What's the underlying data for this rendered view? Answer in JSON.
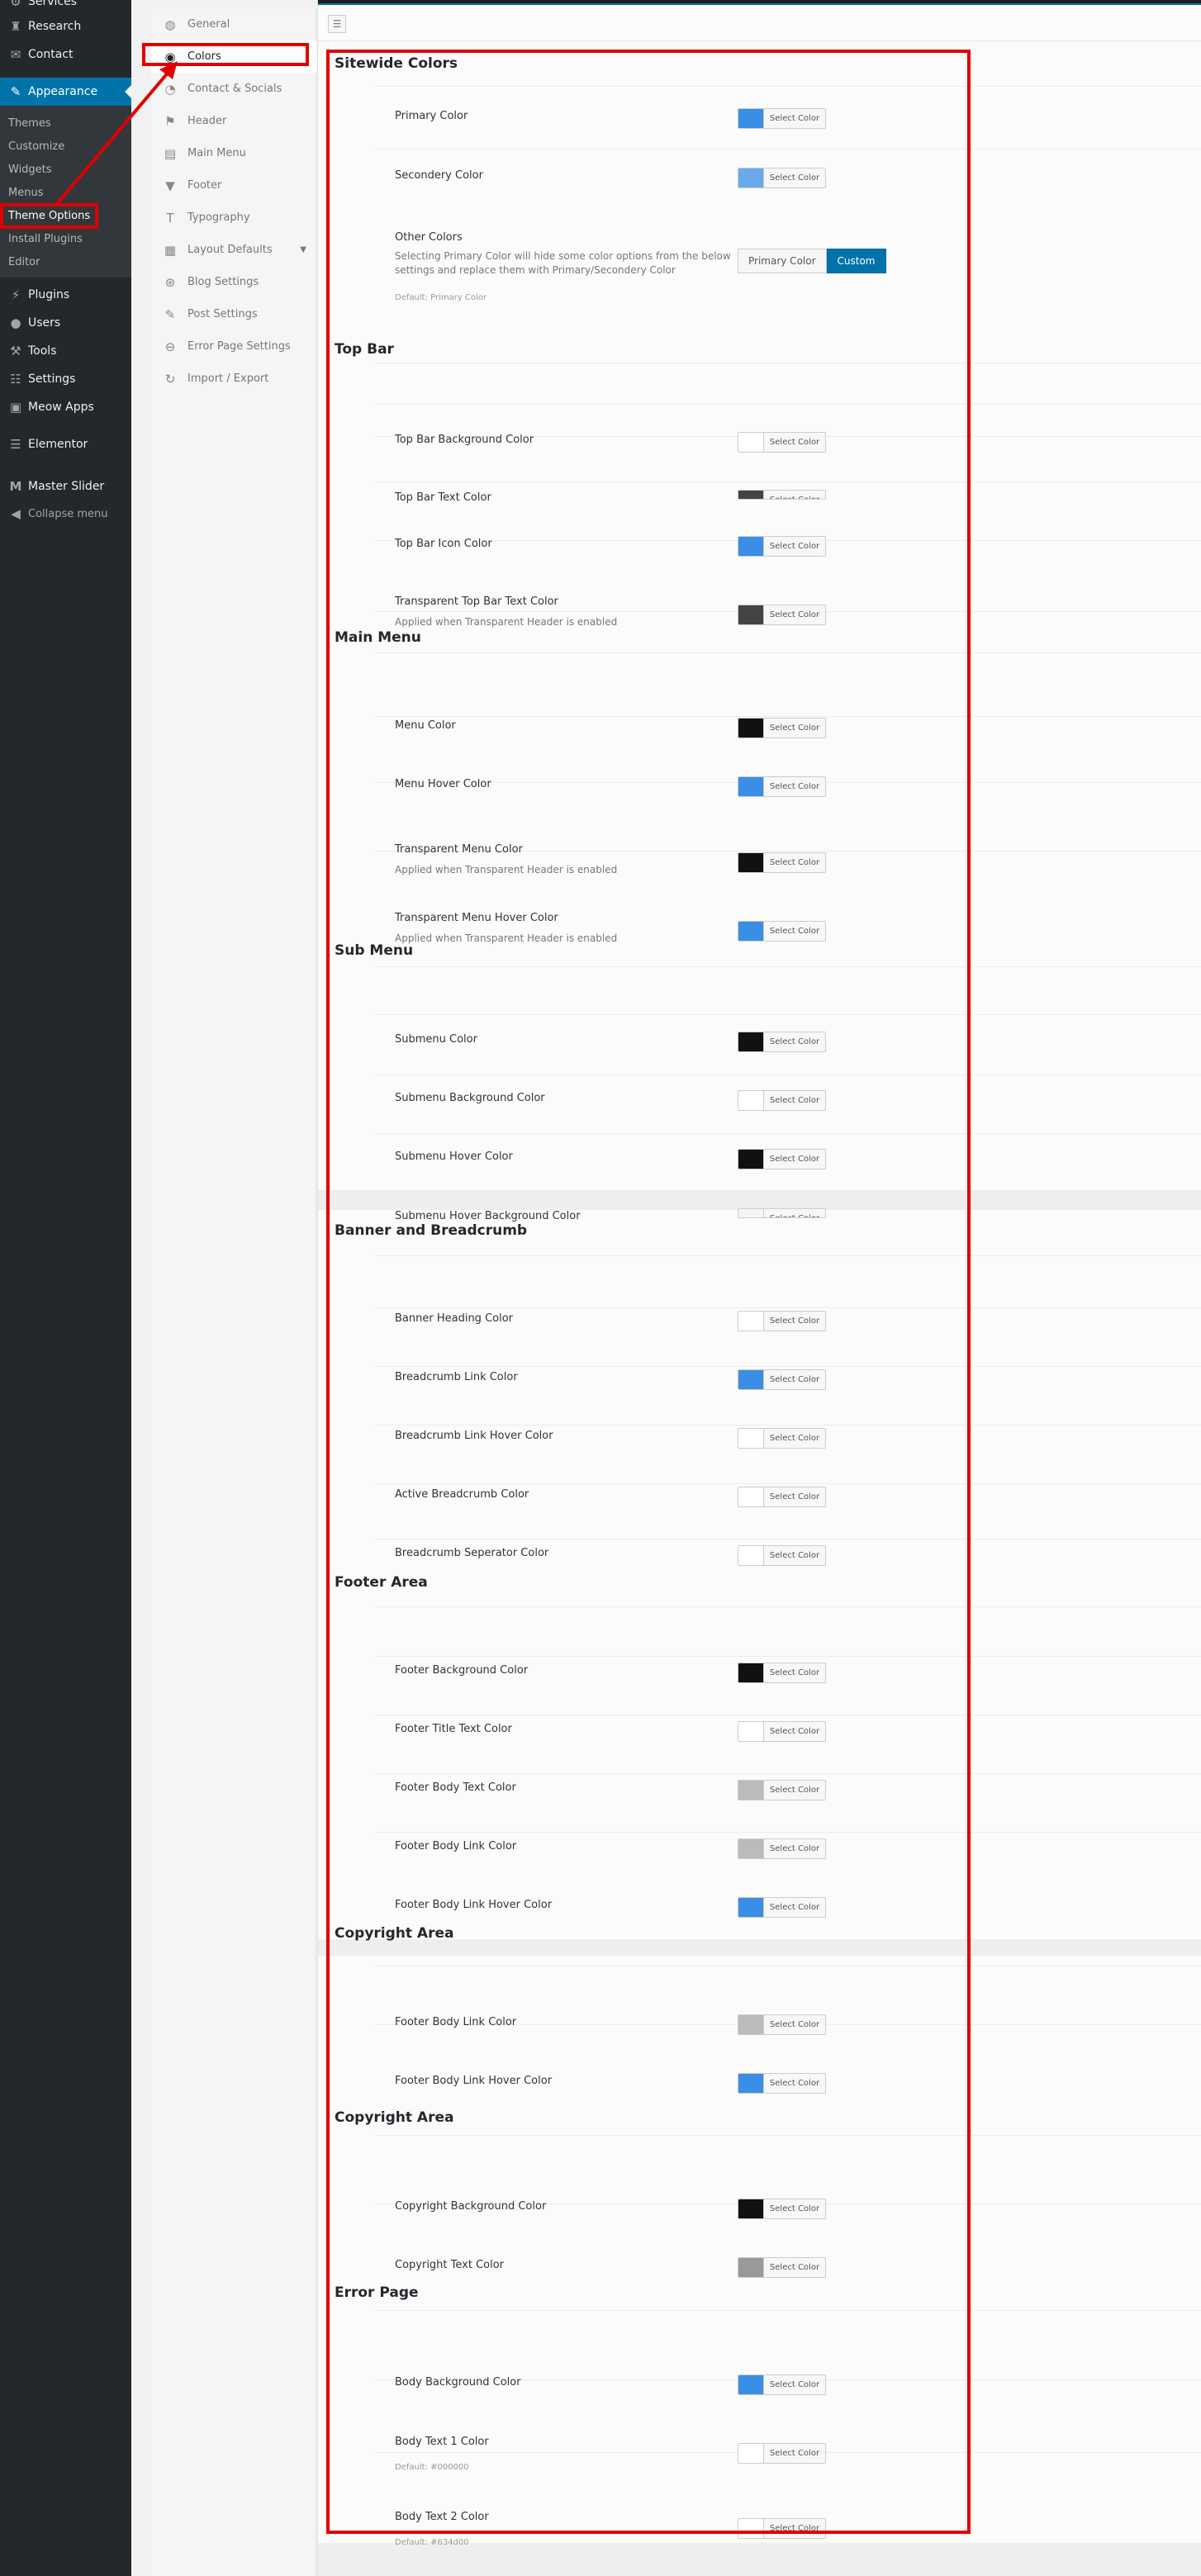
{
  "wp_menu": {
    "services": "Services",
    "research": "Research",
    "contact": "Contact",
    "appearance": "Appearance",
    "appearance_sub": [
      "Themes",
      "Customize",
      "Widgets",
      "Menus",
      "Theme Options",
      "Install Plugins",
      "Editor"
    ],
    "plugins": "Plugins",
    "users": "Users",
    "tools": "Tools",
    "settings": "Settings",
    "meow_apps": "Meow Apps",
    "elementor": "Elementor",
    "master_slider": "Master Slider",
    "collapse": "Collapse menu"
  },
  "options_nav": [
    "General",
    "Colors",
    "Contact & Socials",
    "Header",
    "Main Menu",
    "Footer",
    "Typography",
    "Layout Defaults",
    "Blog Settings",
    "Post Settings",
    "Error Page Settings",
    "Import / Export"
  ],
  "select_color_label": "Select Color",
  "sections": [
    {
      "title": "Sitewide Colors",
      "fields": [
        {
          "label": "Primary Color",
          "color": "#3a8ee6"
        },
        {
          "label": "Secondery Color",
          "color": "#6aa9ea"
        },
        {
          "label": "Other Colors",
          "desc": "Selecting Primary Color will hide some color options from the below settings and replace them with Primary/Secondery Color",
          "default": "Default: Primary Color",
          "buttons": [
            "Primary Color",
            "Custom"
          ]
        }
      ]
    },
    {
      "title": "Top Bar",
      "fields": [
        {
          "label": "Top Bar Background Color",
          "color": "#ffffff"
        },
        {
          "label": "Top Bar Text Color",
          "color": "#444444"
        },
        {
          "label": "Top Bar Icon Color",
          "color": "#3a8ee6"
        },
        {
          "label": "Transparent Top Bar Text Color",
          "desc": "Applied when Transparent Header is enabled",
          "color": "#444444"
        }
      ]
    },
    {
      "title": "Main Menu",
      "fields": [
        {
          "label": "Menu Color",
          "color": "#111111"
        },
        {
          "label": "Menu Hover Color",
          "color": "#3a8ee6"
        },
        {
          "label": "Transparent Menu Color",
          "desc": "Applied when Transparent Header is enabled",
          "color": "#111111"
        },
        {
          "label": "Transparent Menu Hover Color",
          "desc": "Applied when Transparent Header is enabled",
          "color": "#3a8ee6"
        }
      ]
    },
    {
      "title": "Sub Menu",
      "fields": [
        {
          "label": "Submenu Color",
          "color": "#111111"
        },
        {
          "label": "Submenu Background Color",
          "color": "#ffffff"
        },
        {
          "label": "Submenu Hover Color",
          "color": "#111111"
        },
        {
          "label": "Submenu Hover Background Color",
          "color": "#f2f5f8"
        }
      ]
    },
    {
      "title": "Banner and Breadcrumb",
      "fields": [
        {
          "label": "Banner Heading Color",
          "color": "#ffffff"
        },
        {
          "label": "Breadcrumb Link Color",
          "color": "#3a8ee6"
        },
        {
          "label": "Breadcrumb Link Hover Color",
          "color": "#ffffff"
        },
        {
          "label": "Active Breadcrumb Color",
          "color": "#ffffff"
        },
        {
          "label": "Breadcrumb Seperator Color",
          "color": "#ffffff"
        }
      ]
    },
    {
      "title": "Footer Area",
      "fields": [
        {
          "label": "Footer Background Color",
          "color": "#111111"
        },
        {
          "label": "Footer Title Text Color",
          "color": "#ffffff"
        },
        {
          "label": "Footer Body Text Color",
          "color": "#bbbbbb"
        },
        {
          "label": "Footer Body Link Color",
          "color": "#bbbbbb"
        },
        {
          "label": "Footer Body Link Hover Color",
          "color": "#3a8ee6"
        }
      ]
    },
    {
      "title": "Copyright Area",
      "fields": [
        {
          "label": "Footer Body Link Color",
          "color": "#bbbbbb"
        },
        {
          "label": "Footer Body Link Hover Color",
          "color": "#3a8ee6"
        }
      ]
    },
    {
      "title": "Copyright Area",
      "fields": [
        {
          "label": "Copyright Background Color",
          "color": "#111111"
        },
        {
          "label": "Copyright Text Color",
          "color": "#999999"
        }
      ]
    },
    {
      "title": "Error Page",
      "fields": [
        {
          "label": "Body Background Color",
          "color": "#3a8ee6"
        },
        {
          "label": "Body Text 1 Color",
          "default": "Default: #000000",
          "color": "#ffffff"
        },
        {
          "label": "Body Text 2 Color",
          "default": "Default: #634d00",
          "color": "#ffffff"
        }
      ]
    }
  ]
}
